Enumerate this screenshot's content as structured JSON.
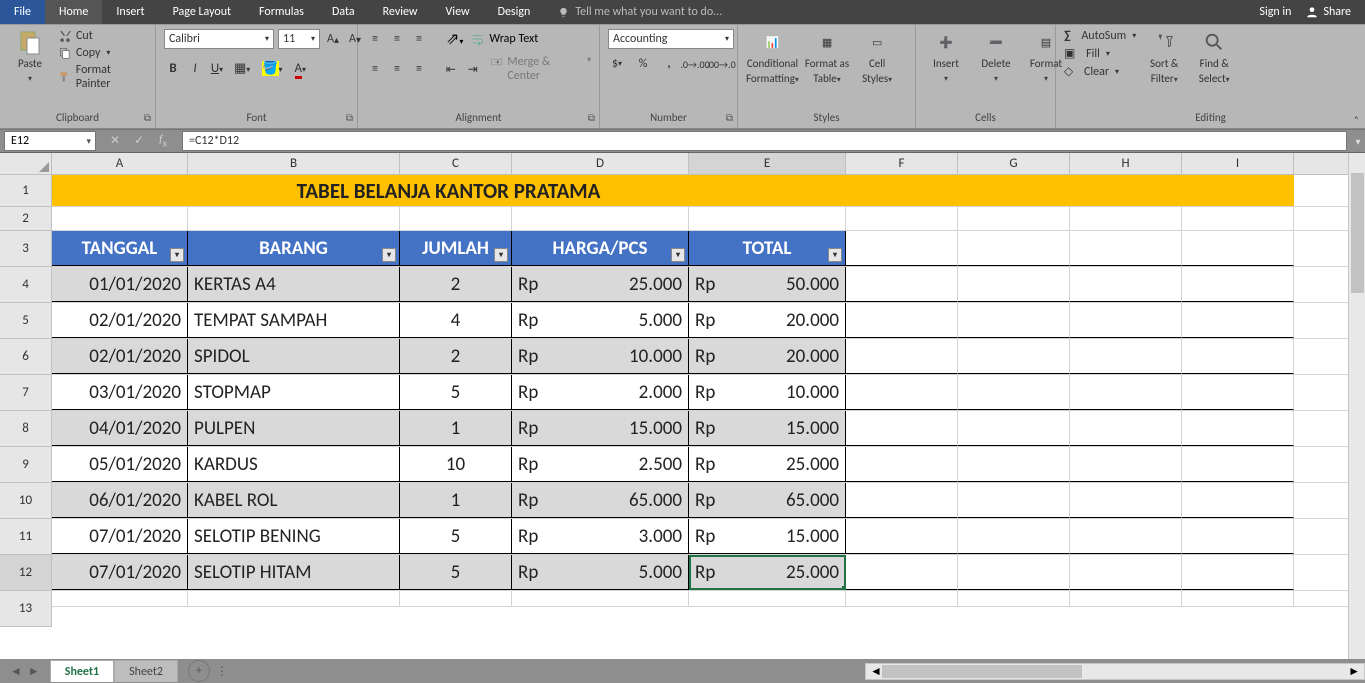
{
  "menu": {
    "tabs": [
      "File",
      "Home",
      "Insert",
      "Page Layout",
      "Formulas",
      "Data",
      "Review",
      "View",
      "Design"
    ],
    "tell": "Tell me what you want to do...",
    "signin": "Sign in",
    "share": "Share"
  },
  "ribbon": {
    "clipboard": {
      "paste": "Paste",
      "cut": "Cut",
      "copy": "Copy",
      "fmtpainter": "Format Painter",
      "caption": "Clipboard"
    },
    "font": {
      "name": "Calibri",
      "size": "11",
      "caption": "Font"
    },
    "alignment": {
      "wrap": "Wrap Text",
      "merge": "Merge & Center",
      "caption": "Alignment"
    },
    "number": {
      "format": "Accounting",
      "caption": "Number"
    },
    "styles": {
      "cond": "Conditional",
      "cond2": "Formatting",
      "fmtas": "Format as",
      "fmtas2": "Table",
      "cellst": "Cell",
      "cellst2": "Styles",
      "caption": "Styles"
    },
    "cells": {
      "insert": "Insert",
      "delete": "Delete",
      "format": "Format",
      "caption": "Cells"
    },
    "editing": {
      "autosum": "AutoSum",
      "fill": "Fill",
      "clear": "Clear",
      "sort": "Sort &",
      "sort2": "Filter",
      "find": "Find &",
      "find2": "Select",
      "caption": "Editing"
    }
  },
  "fx": {
    "namebox": "E12",
    "formula": "=C12*D12"
  },
  "cols": [
    "A",
    "B",
    "C",
    "D",
    "E",
    "F",
    "G",
    "H",
    "I"
  ],
  "rowcount": 12,
  "title": "TABEL BELANJA KANTOR PRATAMA",
  "headers": [
    "TANGGAL",
    "BARANG",
    "JUMLAH",
    "HARGA/PCS",
    "TOTAL"
  ],
  "currency": "Rp",
  "rows": [
    {
      "tgl": "01/01/2020",
      "barang": "KERTAS A4",
      "jml": "2",
      "harga": "25.000",
      "total": "50.000"
    },
    {
      "tgl": "02/01/2020",
      "barang": "TEMPAT SAMPAH",
      "jml": "4",
      "harga": "5.000",
      "total": "20.000"
    },
    {
      "tgl": "02/01/2020",
      "barang": "SPIDOL",
      "jml": "2",
      "harga": "10.000",
      "total": "20.000"
    },
    {
      "tgl": "03/01/2020",
      "barang": "STOPMAP",
      "jml": "5",
      "harga": "2.000",
      "total": "10.000"
    },
    {
      "tgl": "04/01/2020",
      "barang": "PULPEN",
      "jml": "1",
      "harga": "15.000",
      "total": "15.000"
    },
    {
      "tgl": "05/01/2020",
      "barang": "KARDUS",
      "jml": "10",
      "harga": "2.500",
      "total": "25.000"
    },
    {
      "tgl": "06/01/2020",
      "barang": "KABEL ROL",
      "jml": "1",
      "harga": "65.000",
      "total": "65.000"
    },
    {
      "tgl": "07/01/2020",
      "barang": "SELOTIP BENING",
      "jml": "5",
      "harga": "3.000",
      "total": "15.000"
    },
    {
      "tgl": "07/01/2020",
      "barang": "SELOTIP HITAM",
      "jml": "5",
      "harga": "5.000",
      "total": "25.000"
    }
  ],
  "sheets": [
    "Sheet1",
    "Sheet2"
  ]
}
